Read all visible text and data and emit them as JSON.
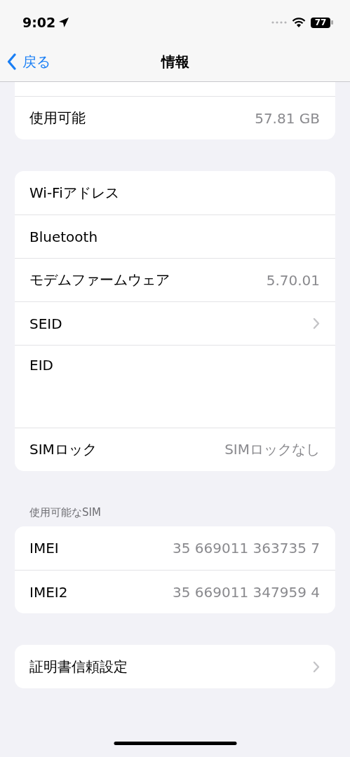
{
  "status_bar": {
    "time": "9:02",
    "battery": "77"
  },
  "nav": {
    "back": "戻る",
    "title": "情報"
  },
  "groups": [
    {
      "clipped": true,
      "rows": [
        {
          "kind": "value",
          "label": "使用可能",
          "value": "57.81 GB"
        }
      ]
    },
    {
      "clipped": false,
      "rows": [
        {
          "kind": "value",
          "label": "Wi-Fiアドレス"
        },
        {
          "kind": "value",
          "label": "Bluetooth"
        },
        {
          "kind": "value",
          "label": "モデムファームウェア",
          "value": "5.70.01"
        },
        {
          "kind": "link",
          "label": "SEID"
        },
        {
          "kind": "tall",
          "label": "EID"
        },
        {
          "kind": "value",
          "label": "SIMロック",
          "value": "SIMロックなし"
        }
      ]
    },
    {
      "clipped": false,
      "header": "使用可能なSIM",
      "rows": [
        {
          "kind": "value",
          "label": "IMEI",
          "value": "35 669011 363735 7"
        },
        {
          "kind": "value",
          "label": "IMEI2",
          "value": "35 669011 347959 4"
        }
      ]
    },
    {
      "clipped": false,
      "rows": [
        {
          "kind": "link",
          "label": "証明書信頼設定"
        }
      ]
    }
  ]
}
